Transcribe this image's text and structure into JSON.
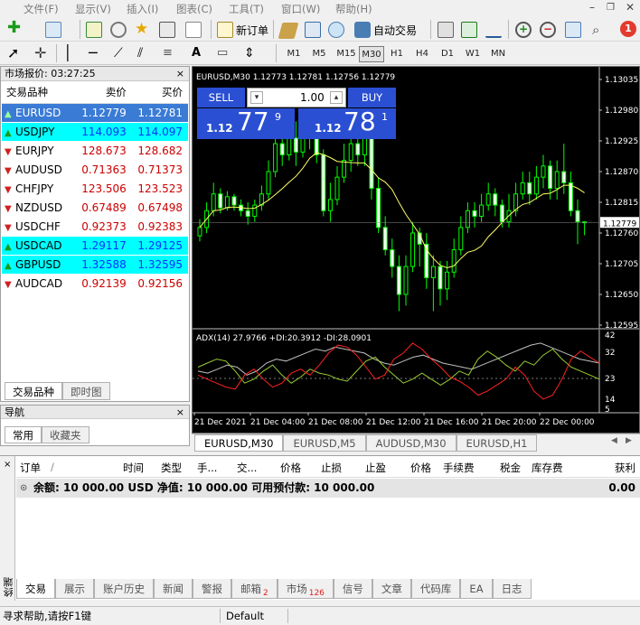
{
  "menu": [
    "文件(F)",
    "显示(V)",
    "插入(I)",
    "图表(C)",
    "工具(T)",
    "窗口(W)",
    "帮助(H)"
  ],
  "toolbar": {
    "new_order": "新订单",
    "auto_trading": "自动交易",
    "notif_count": "1"
  },
  "timeframes": [
    "M1",
    "M5",
    "M15",
    "M30",
    "H1",
    "H4",
    "D1",
    "W1",
    "MN"
  ],
  "selected_timeframe": "M30",
  "market_watch": {
    "title": "市场报价: 03:27:25",
    "headers": [
      "交易品种",
      "卖价",
      "买价"
    ],
    "rows": [
      {
        "symbol": "EURUSD",
        "bid": "1.12779",
        "ask": "1.12781",
        "dir": "up",
        "selected": true
      },
      {
        "symbol": "USDJPY",
        "bid": "114.093",
        "ask": "114.097",
        "dir": "up"
      },
      {
        "symbol": "EURJPY",
        "bid": "128.673",
        "ask": "128.682",
        "dir": "down"
      },
      {
        "symbol": "AUDUSD",
        "bid": "0.71363",
        "ask": "0.71373",
        "dir": "down"
      },
      {
        "symbol": "CHFJPY",
        "bid": "123.506",
        "ask": "123.523",
        "dir": "down"
      },
      {
        "symbol": "NZDUSD",
        "bid": "0.67489",
        "ask": "0.67498",
        "dir": "down"
      },
      {
        "symbol": "USDCHF",
        "bid": "0.92373",
        "ask": "0.92383",
        "dir": "down"
      },
      {
        "symbol": "USDCAD",
        "bid": "1.29117",
        "ask": "1.29125",
        "dir": "up"
      },
      {
        "symbol": "GBPUSD",
        "bid": "1.32588",
        "ask": "1.32595",
        "dir": "up"
      },
      {
        "symbol": "AUDCAD",
        "bid": "0.92139",
        "ask": "0.92156",
        "dir": "down"
      }
    ],
    "tabs": [
      "交易品种",
      "即时图"
    ]
  },
  "navigator": {
    "title": "导航",
    "tabs": [
      "常用",
      "收藏夹"
    ]
  },
  "chart": {
    "header": "EURUSD,M30  1.12773 1.12781 1.12756 1.12779",
    "sell_label": "SELL",
    "buy_label": "BUY",
    "lot": "1.00",
    "sell_prefix": "1.12",
    "sell_big": "77",
    "sell_sup": "9",
    "buy_prefix": "1.12",
    "buy_big": "78",
    "buy_sup": "1",
    "price_ticks": [
      "1.13035",
      "1.12980",
      "1.12925",
      "1.12870",
      "1.12815",
      "1.12760",
      "1.12705",
      "1.12650",
      "1.12595"
    ],
    "current_price": "1.12779",
    "time_ticks": [
      "21 Dec 2021",
      "21 Dec 04:00",
      "21 Dec 08:00",
      "21 Dec 12:00",
      "21 Dec 16:00",
      "21 Dec 20:00",
      "22 Dec 00:00"
    ],
    "adx_label": "ADX(14) 27.9766 +DI:20.3912 -DI:28.0901",
    "adx_ticks": [
      "42",
      "32",
      "23",
      "14",
      "5"
    ],
    "colors": {
      "bull": "#00ff00",
      "bear": "#00ff00",
      "ma": "#ffff66",
      "adx": "#c0c0c0",
      "plus_di": "#9acd32",
      "minus_di": "#ff2222"
    }
  },
  "chart_tabs": [
    "EURUSD,M30",
    "EURUSD,M5",
    "AUDUSD,M30",
    "EURUSD,H1"
  ],
  "terminal": {
    "headers": [
      "订单",
      "时间",
      "类型",
      "手...",
      "交...",
      "价格",
      "止损",
      "止盈",
      "价格",
      "手续费",
      "税金",
      "库存费",
      "获利"
    ],
    "balance_text": "余额: 10 000.00 USD  净值: 10 000.00  可用预付款: 10 000.00",
    "profit": "0.00",
    "side_label": "终端",
    "tabs": [
      {
        "label": "交易",
        "badge": ""
      },
      {
        "label": "展示",
        "badge": ""
      },
      {
        "label": "账户历史",
        "badge": ""
      },
      {
        "label": "新闻",
        "badge": ""
      },
      {
        "label": "警报",
        "badge": ""
      },
      {
        "label": "邮箱",
        "badge": "2"
      },
      {
        "label": "市场",
        "badge": "126"
      },
      {
        "label": "信号",
        "badge": ""
      },
      {
        "label": "文章",
        "badge": ""
      },
      {
        "label": "代码库",
        "badge": ""
      },
      {
        "label": "EA",
        "badge": ""
      },
      {
        "label": "日志",
        "badge": ""
      }
    ]
  },
  "status": {
    "help": "寻求帮助,请按F1键",
    "profile": "Default"
  }
}
